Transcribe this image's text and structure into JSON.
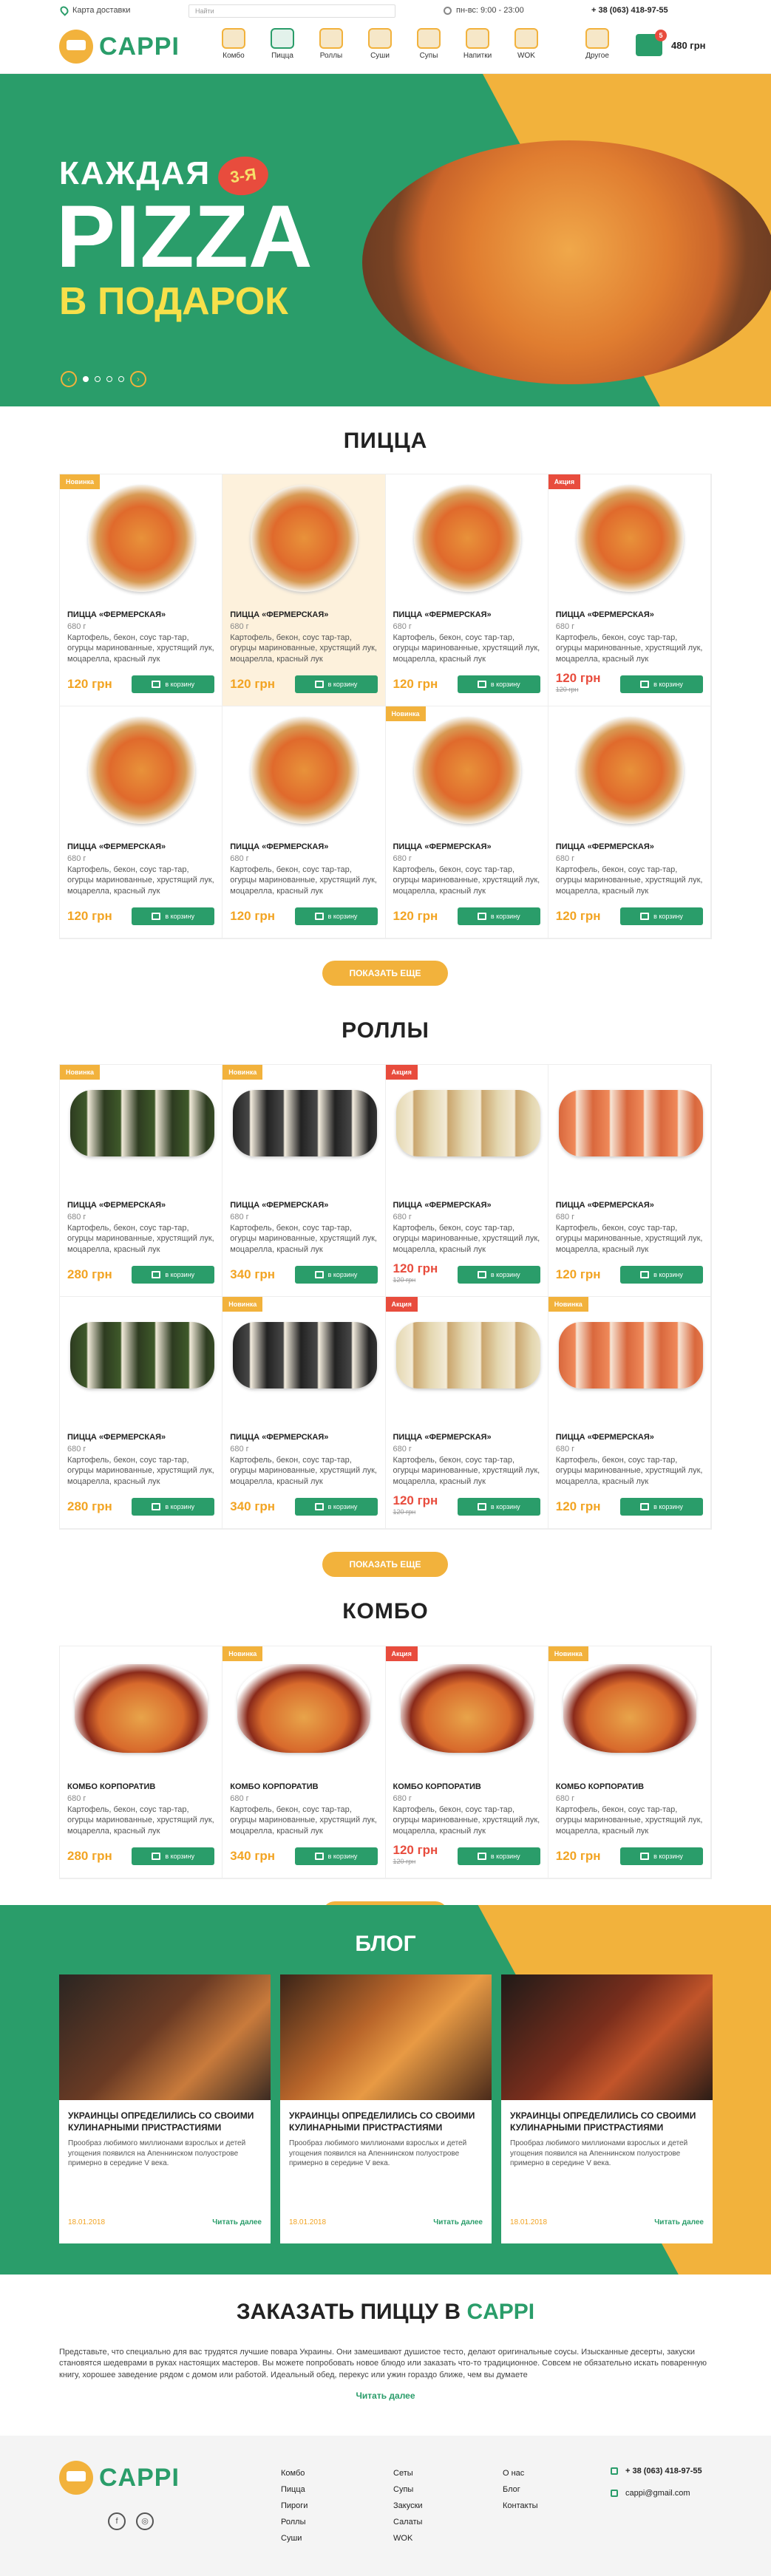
{
  "topbar": {
    "map": "Карта доставки",
    "search_placeholder": "Найти",
    "hours": "пн-вс: 9:00 - 23:00",
    "phone": "+ 38 (063) 418-97-55"
  },
  "brand": "CAPPI",
  "nav": {
    "categories": [
      "Комбо",
      "Пицца",
      "Роллы",
      "Суши",
      "Супы",
      "Напитки",
      "WOK",
      "Другое"
    ],
    "cart_count": "5",
    "cart_total": "480 грн"
  },
  "hero": {
    "line1": "КАЖДАЯ",
    "badge": "3-Я",
    "line2": "PIZZA",
    "line3": "В ПОДАРОК"
  },
  "sections": {
    "pizza": "ПИЦЦА",
    "rolls": "РОЛЛЫ",
    "combo": "КОМБО",
    "more": "ПОКАЗАТЬ ЕЩЕ"
  },
  "product": {
    "pizza_name": "ПИЦЦА «ФЕРМЕРСКАЯ»",
    "combo_name": "КОМБО КОРПОРАТИВ",
    "weight": "680 г",
    "desc": "Картофель, бекон, соус тар-тар, огурцы маринованные, хрустящий лук, моцарелла, красный лук",
    "button": "в корзину",
    "tag_new": "Новинка",
    "tag_promo": "Акция",
    "old_price": "120 грн"
  },
  "pizza_items": [
    {
      "tag": "Новинка",
      "price": "120 грн"
    },
    {
      "tag": "",
      "price": "120 грн"
    },
    {
      "tag": "",
      "price": "120 грн"
    },
    {
      "tag": "Акция",
      "price": "120 грн"
    },
    {
      "tag": "",
      "price": "120 грн"
    },
    {
      "tag": "",
      "price": "120 грн"
    },
    {
      "tag": "Новинка",
      "price": "120 грн"
    },
    {
      "tag": "",
      "price": "120 грн"
    }
  ],
  "roll_items": [
    {
      "tag": "Новинка",
      "price": "280 грн"
    },
    {
      "tag": "Новинка",
      "price": "340 грн"
    },
    {
      "tag": "Акция",
      "price": "120 грн"
    },
    {
      "tag": "",
      "price": "120 грн"
    },
    {
      "tag": "",
      "price": "280 грн"
    },
    {
      "tag": "Новинка",
      "price": "340 грн"
    },
    {
      "tag": "Акция",
      "price": "120 грн"
    },
    {
      "tag": "Новинка",
      "price": "120 грн"
    }
  ],
  "combo_items": [
    {
      "tag": "",
      "price": "280 грн"
    },
    {
      "tag": "Новинка",
      "price": "340 грн"
    },
    {
      "tag": "Акция",
      "price": "120 грн"
    },
    {
      "tag": "Новинка",
      "price": "120 грн"
    }
  ],
  "blog": {
    "title": "БЛОГ",
    "post_title": "УКРАИНЦЫ ОПРЕДЕЛИЛИСЬ СО СВОИМИ КУЛИНАРНЫМИ ПРИСТРАСТИЯМИ",
    "post_text": "Прообраз любимого миллионами взрослых и детей угощения появился на Апеннинском полуострове примерно в середине V века.",
    "date": "18.01.2018",
    "read": "Читать далее"
  },
  "order": {
    "title": "ЗАКАЗАТЬ ПИЦЦУ В",
    "accent": "CAPPI",
    "text": "Представьте, что специально для вас трудятся лучшие повара Украины. Они замешивают душистое тесто, делают оригинальные соусы. Изысканные десерты, закуски становятся шедеврами в руках настоящих мастеров. Вы можете попробовать новое блюдо или заказать что-то традиционное. Совсем не обязательно искать поваренную книгу, хорошее заведение рядом с домом или работой. Идеальный обед, перекус или ужин гораздо ближе, чем вы думаете",
    "read": "Читать далее"
  },
  "footer": {
    "col1": [
      "Комбо",
      "Пицца",
      "Пироги",
      "Роллы",
      "Суши"
    ],
    "col2": [
      "Сеты",
      "Супы",
      "Закуски",
      "Салаты",
      "WOK"
    ],
    "col3": [
      "О нас",
      "Блог",
      "Контакты"
    ],
    "phone": "+ 38 (063) 418-97-55",
    "email": "cappi@gmail.com"
  },
  "colors": {
    "green": "#2a9d6a",
    "yellow": "#f2b23c",
    "red": "#e84c3d"
  }
}
